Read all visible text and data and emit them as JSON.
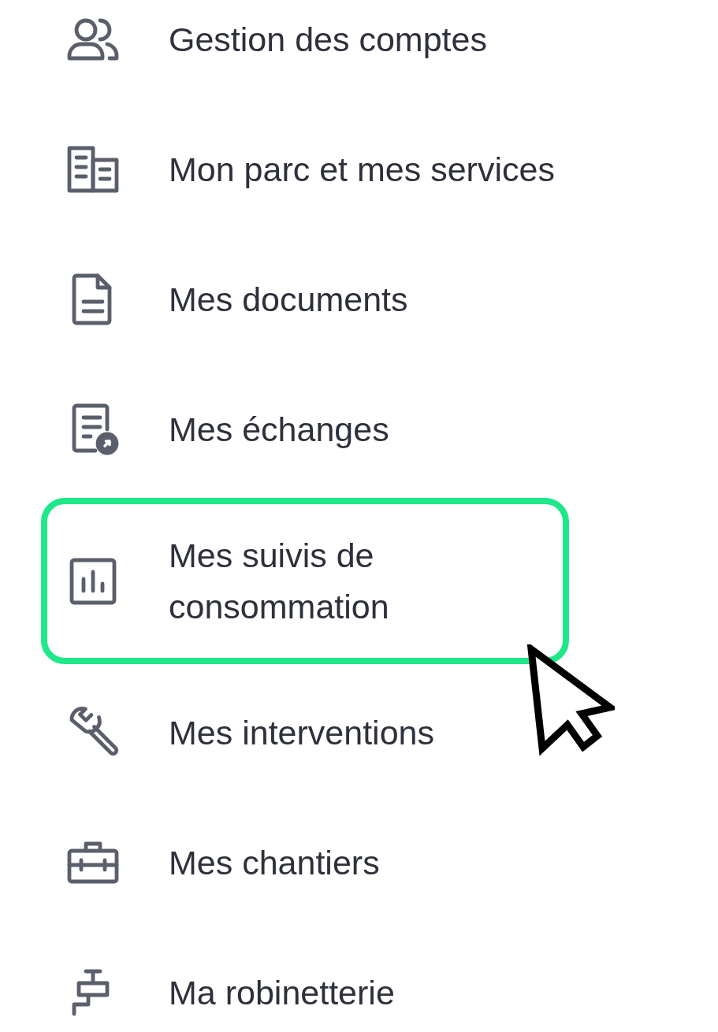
{
  "menu": {
    "items": [
      {
        "label": "Gestion des comptes",
        "selected": false
      },
      {
        "label": "Mon parc et mes services",
        "selected": false
      },
      {
        "label": "Mes documents",
        "selected": false
      },
      {
        "label": "Mes échanges",
        "selected": false
      },
      {
        "label": "Mes suivis de consommation",
        "selected": true
      },
      {
        "label": "Mes interventions",
        "selected": false
      },
      {
        "label": "Mes chantiers",
        "selected": false
      },
      {
        "label": "Ma robinetterie",
        "selected": false
      }
    ]
  }
}
